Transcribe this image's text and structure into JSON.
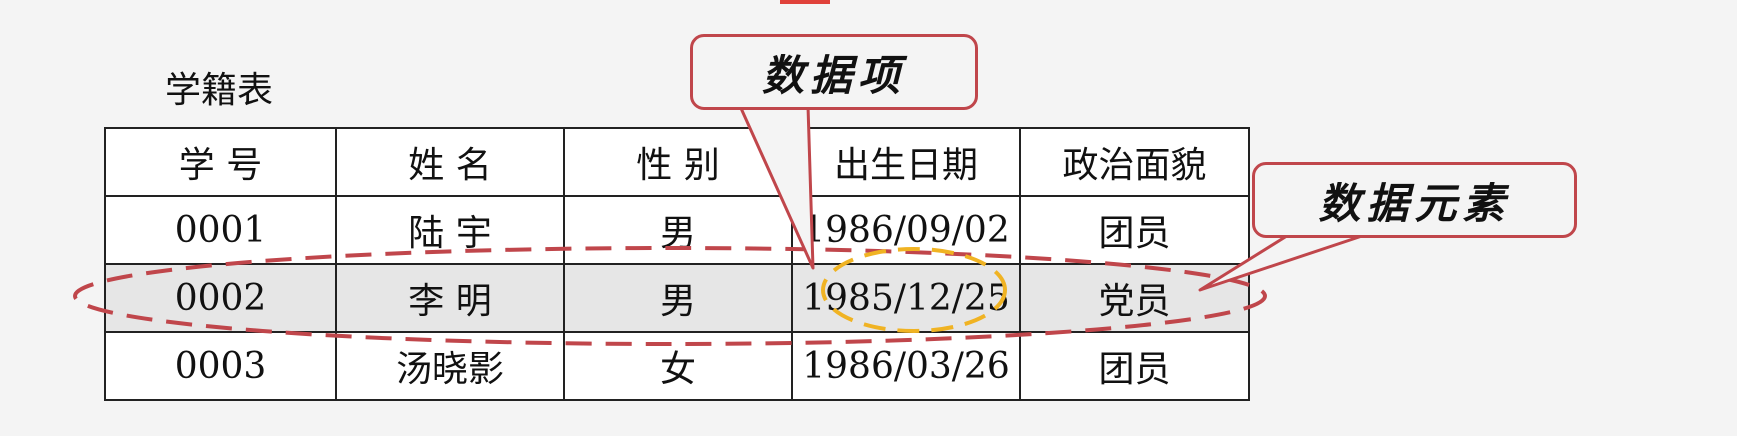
{
  "table": {
    "title": "学籍表",
    "headers": [
      "学  号",
      "姓  名",
      "性  别",
      "出生日期",
      "政治面貌"
    ],
    "rows": [
      [
        "0001",
        "陆  宇",
        "男",
        "1986/09/02",
        "团员"
      ],
      [
        "0002",
        "李  明",
        "男",
        "1985/12/25",
        "党员"
      ],
      [
        "0003",
        "汤晓影",
        "女",
        "1986/03/26",
        "团员"
      ]
    ]
  },
  "annotations": {
    "data_item": "数据项",
    "data_element": "数据元素"
  },
  "colors": {
    "callout_border": "#c0464b",
    "record_highlight_dash": "#c0464b",
    "item_highlight_dash": "#f0b323",
    "top_mark": "#e0413a"
  }
}
